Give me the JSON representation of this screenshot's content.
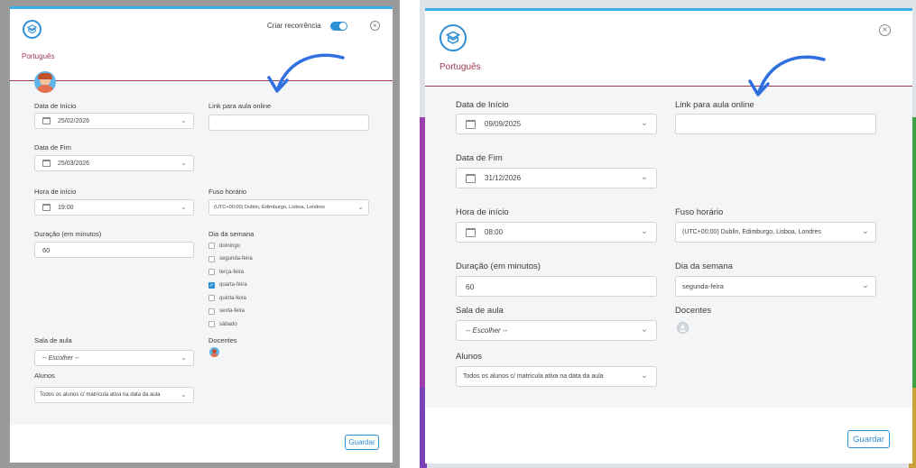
{
  "left": {
    "subject": "Português",
    "recurrence_label": "Criar recorrência",
    "recurrence_on": true,
    "start_date": {
      "label": "Data de Início",
      "value": "25/02/2026"
    },
    "end_date": {
      "label": "Data de Fim",
      "value": "25/03/2026"
    },
    "start_time": {
      "label": "Hora de início",
      "value": "19:00"
    },
    "duration": {
      "label": "Duração (em minutos)",
      "value": "60"
    },
    "link": {
      "label": "Link para aula online",
      "value": ""
    },
    "timezone": {
      "label": "Fuso horário",
      "value": "(UTC+00:00) Dublin, Edimburgo, Lisboa, Londres"
    },
    "weekdays": {
      "label": "Dia da semana",
      "items": [
        {
          "label": "domingo",
          "checked": false
        },
        {
          "label": "segunda-feira",
          "checked": false
        },
        {
          "label": "terça-feira",
          "checked": false
        },
        {
          "label": "quarta-feira",
          "checked": true
        },
        {
          "label": "quinta-feira",
          "checked": false
        },
        {
          "label": "sexta-feira",
          "checked": false
        },
        {
          "label": "sábado",
          "checked": false
        }
      ]
    },
    "room": {
      "label": "Sala de aula",
      "value": "-- Escolher --"
    },
    "teachers": {
      "label": "Docentes"
    },
    "students": {
      "label": "Alunos",
      "value": "Todos os alunos c/ matrícula ativa na data da aula"
    },
    "save_label": "Guardar"
  },
  "right": {
    "subject": "Português",
    "start_date": {
      "label": "Data de Início",
      "value": "09/09/2025"
    },
    "end_date": {
      "label": "Data de Fim",
      "value": "31/12/2026"
    },
    "start_time": {
      "label": "Hora de início",
      "value": "08:00"
    },
    "duration": {
      "label": "Duração (em minutos)",
      "value": "60"
    },
    "link": {
      "label": "Link para aula online",
      "value": ""
    },
    "timezone": {
      "label": "Fuso horário",
      "value": "(UTC+00:00) Dublin, Edimburgo, Lisboa, Londres"
    },
    "weekday": {
      "label": "Dia da semana",
      "value": "segunda-feira"
    },
    "room": {
      "label": "Sala de aula",
      "value": "-- Escolher --"
    },
    "teachers": {
      "label": "Docentes"
    },
    "students": {
      "label": "Alunos",
      "value": "Todos os alunos c/ matrícula ativa na data da aula"
    },
    "save_label": "Guardar"
  },
  "colors": {
    "accent": "#2d8fd6",
    "subject": "#a13a52",
    "arrow": "#2f6fe0"
  }
}
